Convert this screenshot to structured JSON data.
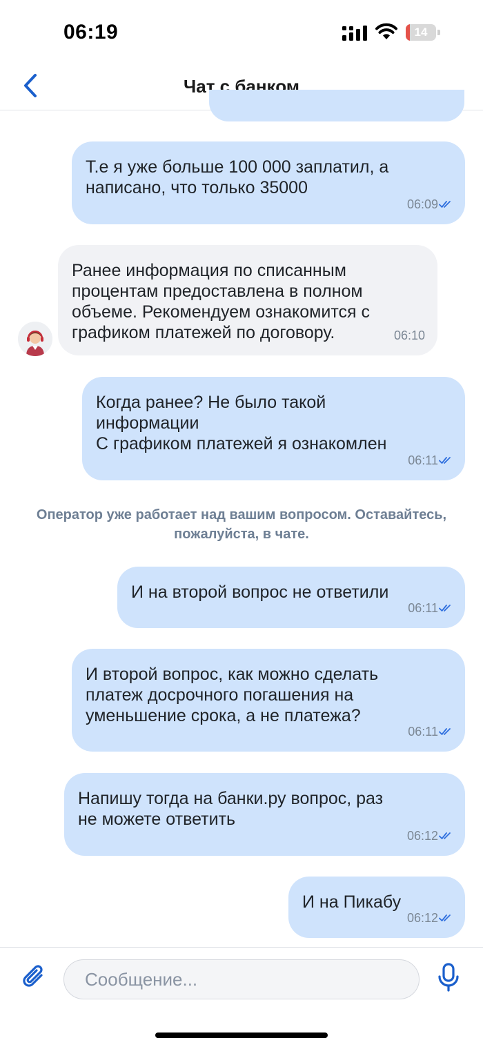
{
  "status_bar": {
    "time": "06:19",
    "battery_level": "14",
    "battery_color": "#e5524a"
  },
  "header": {
    "title": "Чат с банком",
    "back_icon": "chevron-left-icon"
  },
  "messages": [
    {
      "direction": "outgoing",
      "text": "Т.е я уже больше 100 000 заплатил, а\nнаписано, что только 35000",
      "time": "06:09",
      "read": true
    },
    {
      "direction": "incoming",
      "text": "Ранее информация по списанным\nпроцентам предоставлена в полном\nобъеме. Рекомендуем ознакомится с\nграфиком платежей по договору.",
      "time": "06:10"
    },
    {
      "direction": "outgoing",
      "text": "Когда ранее? Не было такой\nинформации\nС графиком платежей я ознакомлен",
      "time": "06:11",
      "read": true
    },
    {
      "direction": "outgoing",
      "text": "И на второй вопрос не ответили",
      "time": "06:11",
      "read": true
    },
    {
      "direction": "outgoing",
      "text": "И второй вопрос, как можно сделать\nплатеж досрочного погашения на\nуменьшение срока, а не платежа?",
      "time": "06:11",
      "read": true
    },
    {
      "direction": "outgoing",
      "text": "Напишу тогда на банки.ру вопрос, раз\nне можете ответить",
      "time": "06:12",
      "read": true
    },
    {
      "direction": "outgoing",
      "text": "И на Пикабу",
      "time": "06:12",
      "read": true
    }
  ],
  "system_note": "Оператор уже работает над вашим вопросом. Оставайтесь, пожалуйста, в чате.",
  "composer": {
    "placeholder": "Сообщение...",
    "value": "",
    "attach_icon": "paperclip-icon",
    "mic_icon": "microphone-icon"
  },
  "colors": {
    "accent": "#1a5fcc",
    "outgoing_bubble": "#cfe3fc",
    "incoming_bubble": "#f1f2f5",
    "read_tick": "#2f6fde"
  }
}
